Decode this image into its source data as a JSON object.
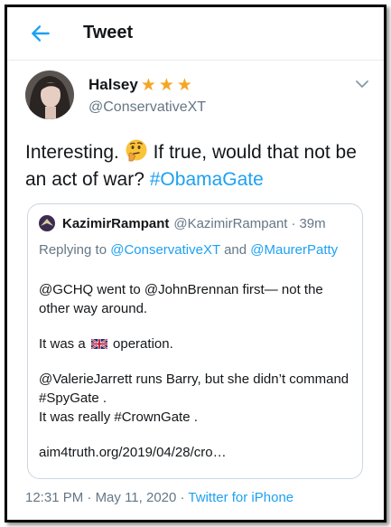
{
  "header": {
    "title": "Tweet",
    "back_icon": "back-arrow-icon"
  },
  "colors": {
    "accent": "#1da1f2",
    "secondary_text": "#657786",
    "star": "#f5a623"
  },
  "tweet": {
    "author_name": "Halsey",
    "badge_stars": [
      "★",
      "★",
      "★"
    ],
    "handle": "@ConservativeXT",
    "text_part1": "Interesting.",
    "emoji_icon": "thinking-face-icon",
    "text_part2": "If true, would that not be an act of war?",
    "hashtag": "#ObamaGate"
  },
  "quoted": {
    "author_name": "KazimirRampant",
    "handle": "@KazimirRampant",
    "separator": "·",
    "time": "39m",
    "replying_prefix": "Replying to",
    "replying_to_1": "@ConservativeXT",
    "replying_and": "and",
    "replying_to_2": "@MaurerPatty",
    "line1": "@GCHQ went to @JohnBrennan first— not the other way around.",
    "line2_before": "It was a",
    "flag_icon": "uk-flag-icon",
    "line2_after": "operation.",
    "line3": "@ValerieJarrett runs Barry, but she didn’t command #SpyGate .",
    "line4": "It was really #CrownGate .",
    "link": "aim4truth.org/2019/04/28/cro…"
  },
  "footer": {
    "time": "12:31 PM",
    "separator": "·",
    "date": "May 11, 2020",
    "separator2": "·",
    "source": "Twitter for iPhone"
  }
}
